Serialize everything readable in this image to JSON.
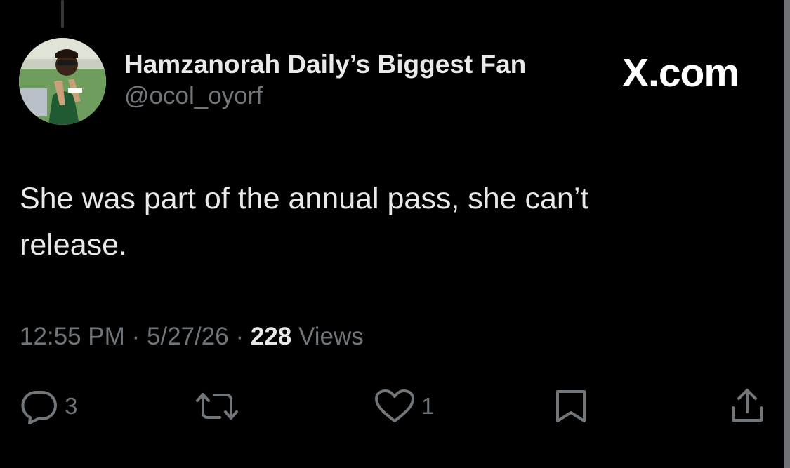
{
  "tweet": {
    "author": {
      "display_name": "Hamzanorah Daily’s Biggest Fan",
      "handle": "@ocol_oyorf"
    },
    "brand": "X.com",
    "text_lines": [
      "She was part of the annual pass, she can’t",
      "release."
    ],
    "meta": {
      "time": "12:55 PM",
      "date": "5/27/26",
      "separator": "·",
      "views_count": "228",
      "views_label": "Views"
    },
    "actions": {
      "replies": "3",
      "likes": "1"
    }
  },
  "icons": {
    "reply": "reply-bubble-icon",
    "retweet": "retweet-arrows-icon",
    "like": "heart-icon",
    "bookmark": "bookmark-icon",
    "share": "share-upload-icon"
  },
  "colors": {
    "background": "#000000",
    "primary_text": "#e7e9ea",
    "secondary_text": "#71767b"
  }
}
